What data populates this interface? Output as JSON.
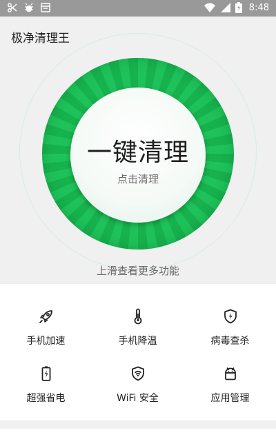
{
  "status_bar": {
    "time": "8:48"
  },
  "app": {
    "title": "极净清理王"
  },
  "hero": {
    "button_title": "一键清理",
    "button_subtitle": "点击清理",
    "swipe_hint": "上滑查看更多功能"
  },
  "features": [
    {
      "label": "手机加速",
      "icon": "rocket-icon"
    },
    {
      "label": "手机降温",
      "icon": "thermometer-icon"
    },
    {
      "label": "病毒查杀",
      "icon": "shield-bolt-icon"
    },
    {
      "label": "超强省电",
      "icon": "battery-icon"
    },
    {
      "label": "WiFi 安全",
      "icon": "wifi-shield-icon"
    },
    {
      "label": "应用管理",
      "icon": "android-icon"
    }
  ],
  "colors": {
    "accent": "#1fc25a",
    "status_bar": "#999999"
  }
}
